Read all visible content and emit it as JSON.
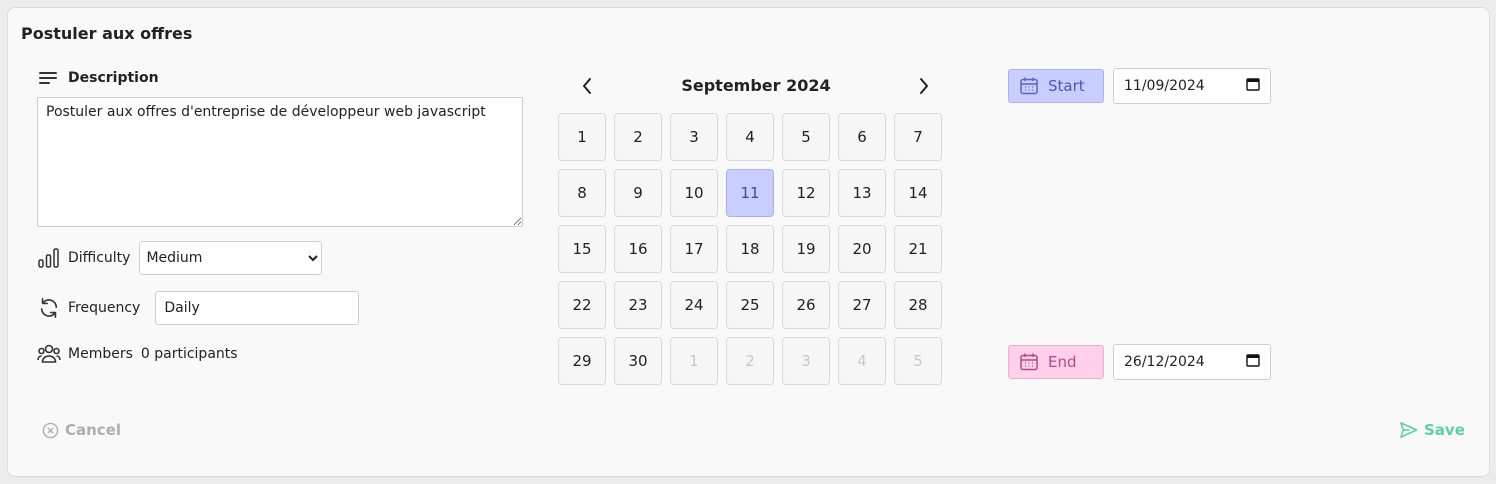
{
  "title": "Postuler aux offres",
  "description": {
    "label": "Description",
    "value": "Postuler aux offres d'entreprise de développeur web javascript"
  },
  "difficulty": {
    "label": "Difficulty",
    "value": "Medium"
  },
  "frequency": {
    "label": "Frequency",
    "value": "Daily"
  },
  "members": {
    "label": "Members",
    "value": "0 participants"
  },
  "calendar": {
    "month": "September 2024",
    "selected_day": "11",
    "days": [
      {
        "label": "1"
      },
      {
        "label": "2"
      },
      {
        "label": "3"
      },
      {
        "label": "4"
      },
      {
        "label": "5"
      },
      {
        "label": "6"
      },
      {
        "label": "7"
      },
      {
        "label": "8"
      },
      {
        "label": "9"
      },
      {
        "label": "10"
      },
      {
        "label": "11",
        "selected": true
      },
      {
        "label": "12"
      },
      {
        "label": "13"
      },
      {
        "label": "14"
      },
      {
        "label": "15"
      },
      {
        "label": "16"
      },
      {
        "label": "17"
      },
      {
        "label": "18"
      },
      {
        "label": "19"
      },
      {
        "label": "20"
      },
      {
        "label": "21"
      },
      {
        "label": "22"
      },
      {
        "label": "23"
      },
      {
        "label": "24"
      },
      {
        "label": "25"
      },
      {
        "label": "26"
      },
      {
        "label": "27"
      },
      {
        "label": "28"
      },
      {
        "label": "29"
      },
      {
        "label": "30"
      },
      {
        "label": "1",
        "muted": true
      },
      {
        "label": "2",
        "muted": true
      },
      {
        "label": "3",
        "muted": true
      },
      {
        "label": "4",
        "muted": true
      },
      {
        "label": "5",
        "muted": true
      }
    ]
  },
  "start": {
    "label": "Start",
    "date": "11/09/2024"
  },
  "end": {
    "label": "End",
    "date": "26/12/2024"
  },
  "footer": {
    "cancel_label": "Cancel",
    "save_label": "Save"
  },
  "colors": {
    "start_bg": "#c8ceff",
    "end_bg": "#ffd0ea",
    "selected_day_bg": "#c8ceff",
    "save": "#5ccfa6",
    "cancel": "#aeaeae"
  },
  "icons": {
    "description": "lines-icon",
    "difficulty": "bar-chart-icon",
    "frequency": "refresh-icon",
    "members": "users-icon",
    "prev": "chevron-left-icon",
    "next": "chevron-right-icon",
    "date_tag": "calendar-icon",
    "date_picker": "calendar-picker-icon",
    "cancel": "x-circle-icon",
    "save": "send-icon"
  }
}
